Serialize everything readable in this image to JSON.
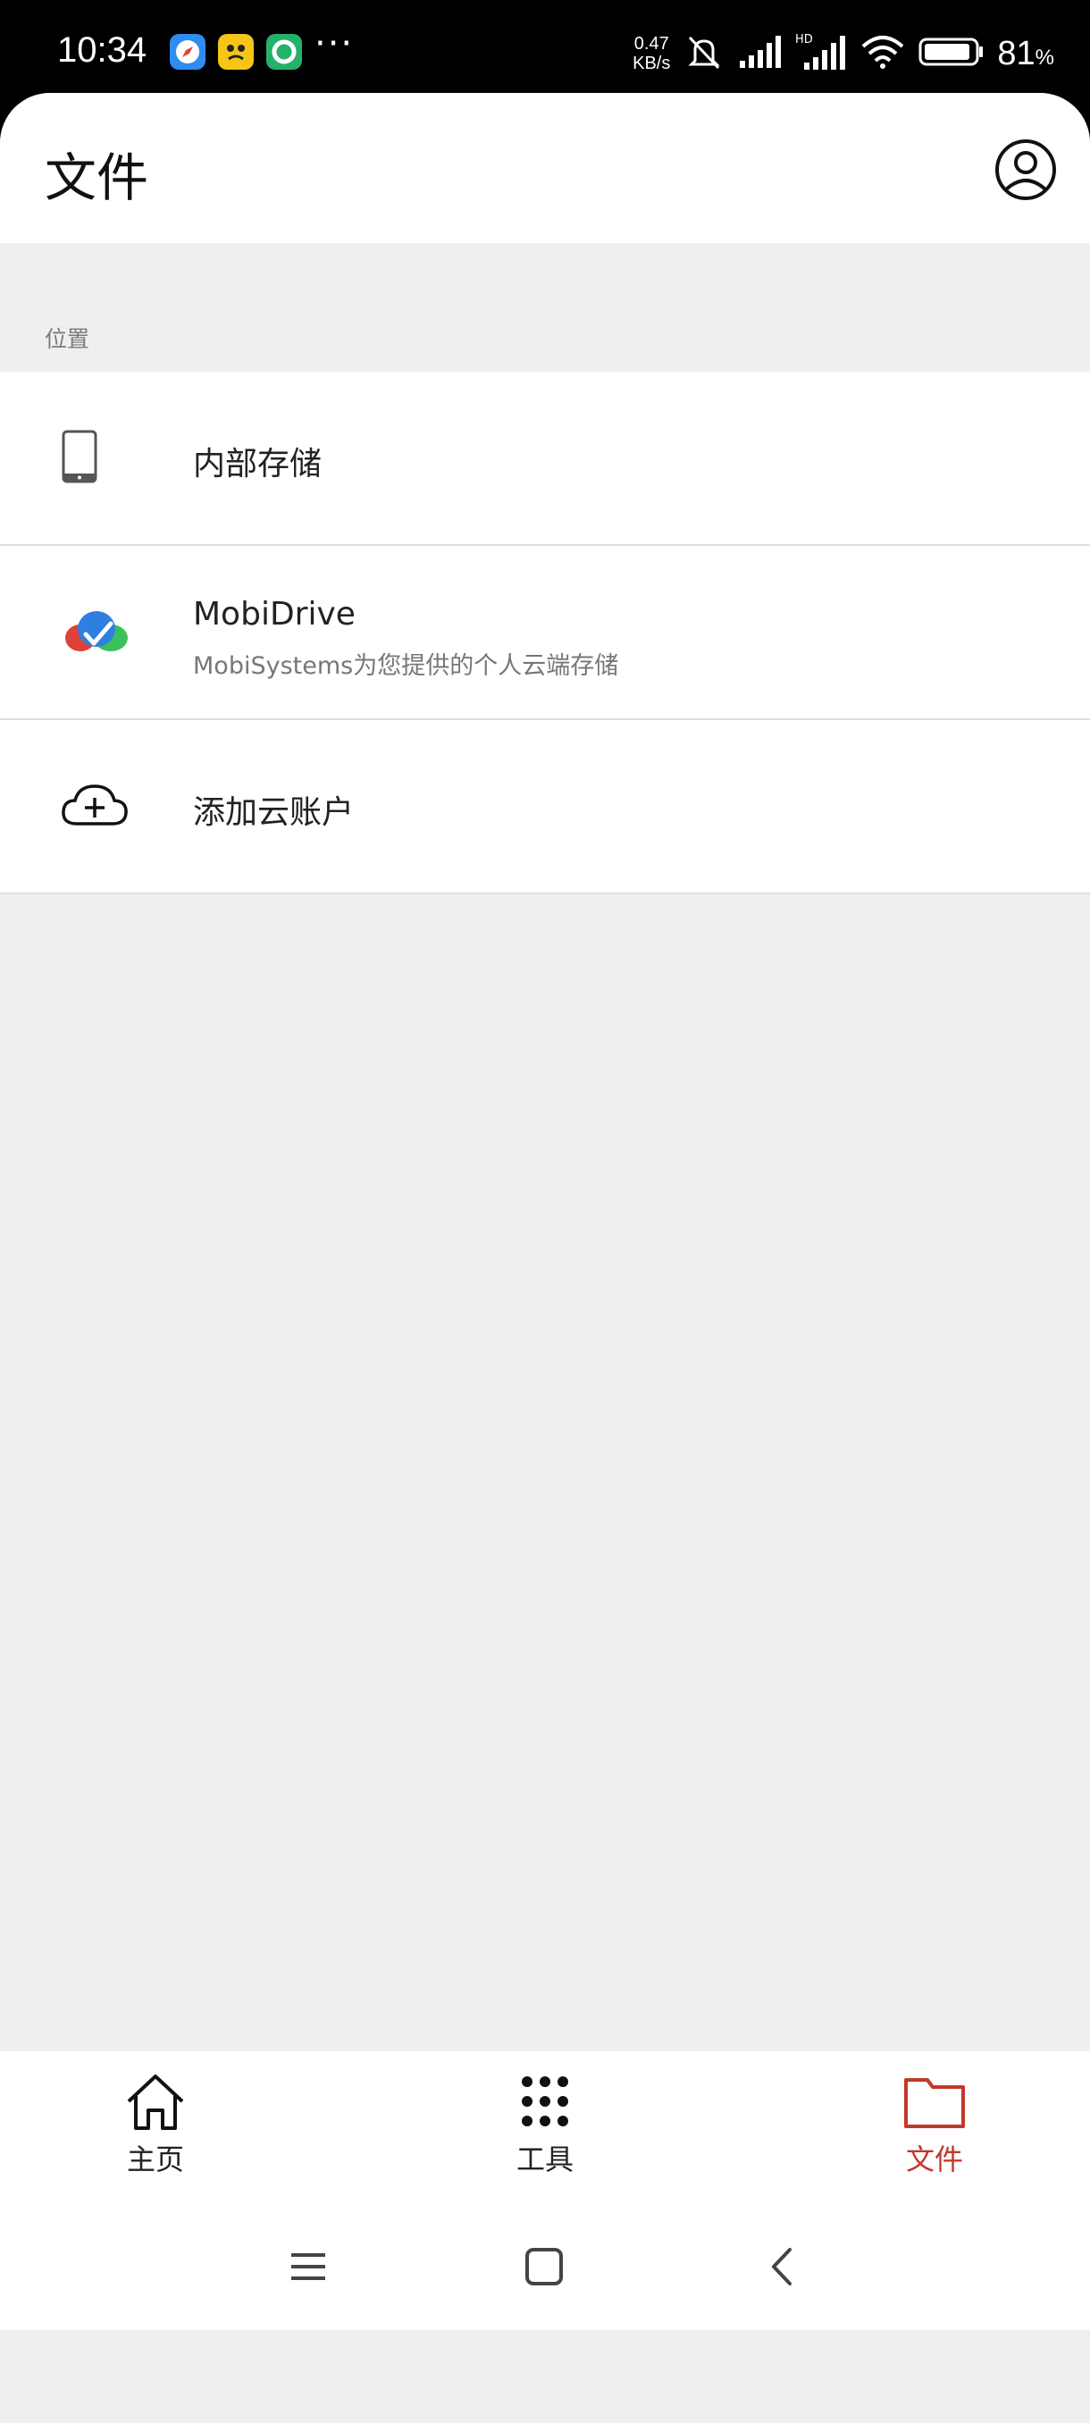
{
  "status_bar": {
    "time": "10:34",
    "net_speed_value": "0.47",
    "net_speed_unit": "KB/s",
    "battery_percent": "81",
    "battery_unit": "%",
    "more_indicator": "···",
    "icons": [
      "compass-app-icon",
      "yellow-app-icon",
      "green-app-icon",
      "silent-bell-icon",
      "signal-icon",
      "hd-signal-icon",
      "wifi-icon",
      "battery-icon"
    ]
  },
  "header": {
    "title": "文件",
    "account_icon": "account-circle-icon"
  },
  "locations": {
    "section_label": "位置",
    "items": [
      {
        "label": "内部存储",
        "icon": "phone-icon"
      },
      {
        "label": "MobiDrive",
        "subtitle": "MobiSystems为您提供的个人云端存储",
        "icon": "mobidrive-logo-icon"
      },
      {
        "label": "添加云账户",
        "icon": "cloud-add-icon"
      }
    ]
  },
  "bottom_nav": {
    "items": [
      {
        "label": "主页",
        "icon": "home-icon",
        "active": false
      },
      {
        "label": "工具",
        "icon": "grid-dots-icon",
        "active": false
      },
      {
        "label": "文件",
        "icon": "folder-icon",
        "active": true
      }
    ],
    "active_color": "#c0392b"
  },
  "system_nav": {
    "buttons": [
      "menu-icon",
      "home-square-icon",
      "back-icon"
    ]
  }
}
